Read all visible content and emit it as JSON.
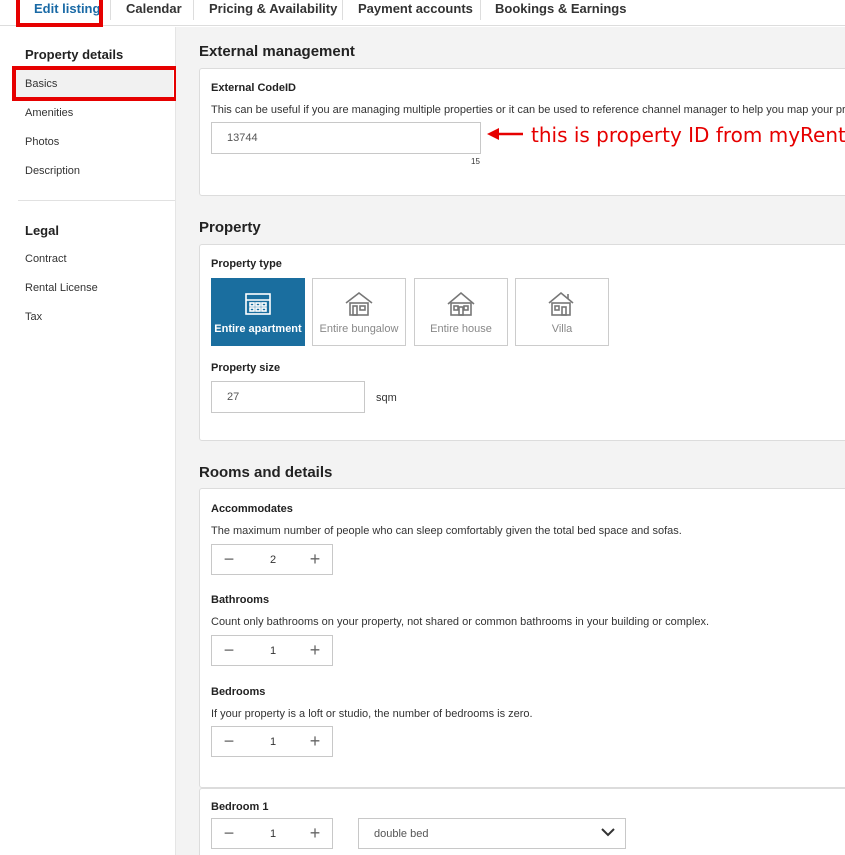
{
  "nav": {
    "tabs": [
      {
        "label": "Edit listing",
        "active": true
      },
      {
        "label": "Calendar"
      },
      {
        "label": "Pricing & Availability"
      },
      {
        "label": "Payment accounts"
      },
      {
        "label": "Bookings & Earnings"
      }
    ]
  },
  "sidebar": {
    "property_heading": "Property details",
    "property_items": [
      "Basics",
      "Amenities",
      "Photos",
      "Description"
    ],
    "legal_heading": "Legal",
    "legal_items": [
      "Contract",
      "Rental License",
      "Tax"
    ]
  },
  "external": {
    "title": "External management",
    "label": "External CodeID",
    "desc": "This can be useful if you are managing multiple properties or it can be used to reference channel manager to help you map your properties",
    "value": "13744",
    "char_count": "15"
  },
  "annotation": "this is property ID from myRent",
  "property": {
    "title": "Property",
    "type_label": "Property type",
    "types": [
      {
        "label": "Entire apartment",
        "icon": "apartment-icon",
        "selected": true
      },
      {
        "label": "Entire bungalow",
        "icon": "bungalow-icon"
      },
      {
        "label": "Entire house",
        "icon": "house-icon"
      },
      {
        "label": "Villa",
        "icon": "villa-icon"
      }
    ],
    "size_label": "Property size",
    "size_value": "27",
    "size_unit": "sqm"
  },
  "rooms": {
    "title": "Rooms and details",
    "accommodates": {
      "label": "Accommodates",
      "desc": "The maximum number of people who can sleep comfortably given the total bed space and sofas.",
      "value": "2"
    },
    "bathrooms": {
      "label": "Bathrooms",
      "desc": "Count only bathrooms on your property, not shared or common bathrooms in your building or complex.",
      "value": "1"
    },
    "bedrooms": {
      "label": "Bedrooms",
      "desc": "If your property is a loft or studio, the number of bedrooms is zero.",
      "value": "1"
    },
    "bedroom1": {
      "label": "Bedroom 1",
      "value": "1",
      "bed_type": "double bed"
    }
  },
  "colors": {
    "accent": "#1a6e9f",
    "annotation": "#e60000"
  }
}
